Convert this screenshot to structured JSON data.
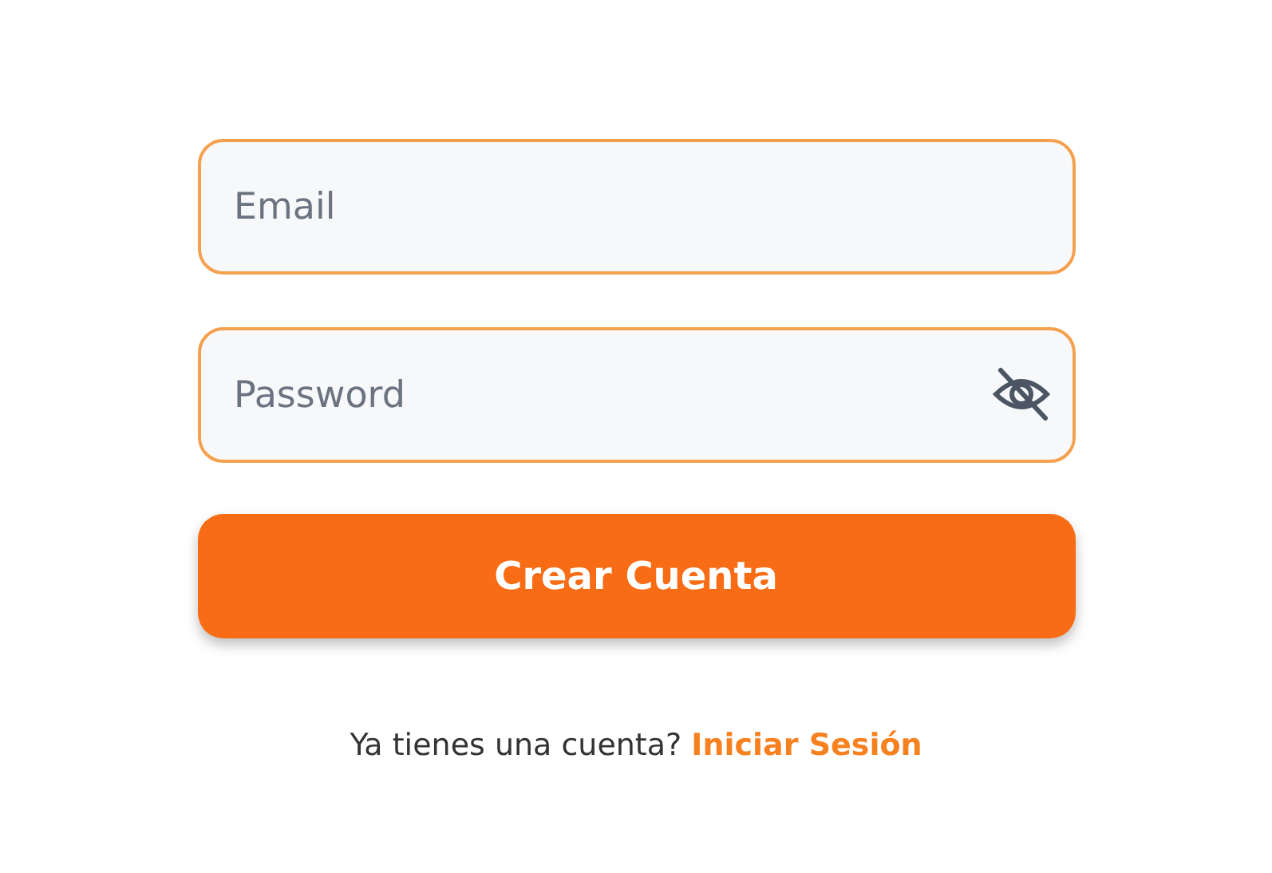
{
  "fields": [
    {
      "kind": "text",
      "placeholder": "Email"
    },
    {
      "kind": "password",
      "placeholder": "Password"
    }
  ],
  "submit_button": {
    "label": "Crear Cuenta"
  },
  "footer": {
    "text": "Ya tienes una cuenta?",
    "link": "Iniciar Sesión"
  }
}
